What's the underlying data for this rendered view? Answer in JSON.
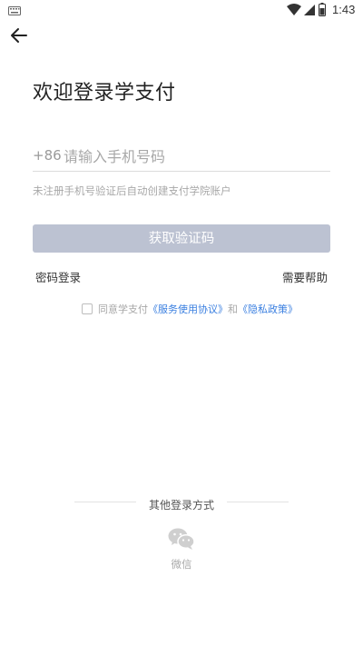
{
  "status_bar": {
    "time": "1:43"
  },
  "header": {
    "back_icon": "arrow-left-icon"
  },
  "title": "欢迎登录学支付",
  "phone": {
    "country_code": "+86",
    "placeholder": "请输入手机号码",
    "value": ""
  },
  "hint": "未注册手机号验证后自动创建支付学院账户",
  "get_code_label": "获取验证码",
  "password_login": "密码登录",
  "need_help": "需要帮助",
  "agreement": {
    "checked": false,
    "prefix": "同意学支付",
    "service_link": "《服务使用协议》",
    "and": "和",
    "privacy_link": "《隐私政策》"
  },
  "other_login": {
    "label": "其他登录方式",
    "wechat_icon": "wechat-icon",
    "wechat_label": "微信"
  },
  "colors": {
    "button_disabled": "#bcc2d2",
    "link": "#3a7fe0",
    "hint_text": "#a8a8a8"
  }
}
